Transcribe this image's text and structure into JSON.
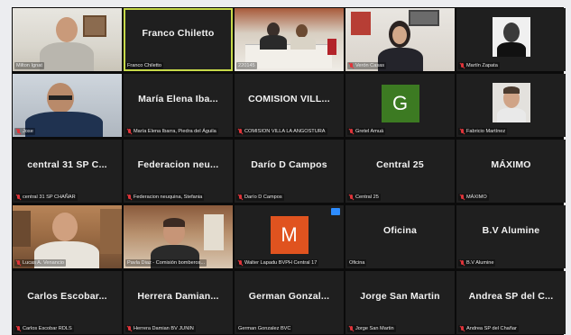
{
  "colors": {
    "active_border": "#c7d94a",
    "muted_icon": "#e0343a",
    "avatar_green": "#3c7a22",
    "avatar_orange": "#e0531f",
    "video_badge": "#2d8cff"
  },
  "tiles": [
    {
      "label": "Milton Ignat",
      "center": "",
      "muted": false
    },
    {
      "label": "Franco Chiletto",
      "center": "Franco Chiletto",
      "muted": false
    },
    {
      "label": "220145",
      "center": "",
      "muted": false
    },
    {
      "label": "Verón Casas",
      "center": "",
      "muted": true
    },
    {
      "label": "Martín Zapata",
      "center": "",
      "muted": true
    },
    {
      "label": "Jose",
      "center": "",
      "muted": true
    },
    {
      "label": "María Elena Ibarra, Piedra del Águila",
      "center": "María Elena Iba...",
      "muted": true
    },
    {
      "label": "COMISION VILLA LA ANGOSTURA",
      "center": "COMISION VILL...",
      "muted": true
    },
    {
      "label": "Gretel Amuá",
      "center": "",
      "muted": true,
      "avatar": "G"
    },
    {
      "label": "Fabricio Martínez",
      "center": "",
      "muted": true
    },
    {
      "label": "central 31 SP CHAÑAR",
      "center": "central 31 SP C...",
      "muted": true
    },
    {
      "label": "Federacion neuquina, Stefania",
      "center": "Federacion neu...",
      "muted": true
    },
    {
      "label": "Darío D Campos",
      "center": "Darío D Campos",
      "muted": true
    },
    {
      "label": "Central 25",
      "center": "Central 25",
      "muted": true
    },
    {
      "label": "MÁXIMO",
      "center": "MÁXIMO",
      "muted": true
    },
    {
      "label": "Lucas A. Venancio",
      "center": "",
      "muted": true
    },
    {
      "label": "Pavla Diaz - Comisión bomberos...",
      "center": "",
      "muted": false
    },
    {
      "label": "Walter Lapadu BVPH Central 17",
      "center": "",
      "muted": true,
      "avatar": "M"
    },
    {
      "label": "Oficina",
      "center": "Oficina",
      "muted": false
    },
    {
      "label": "B.V Alumine",
      "center": "B.V Alumine",
      "muted": true
    },
    {
      "label": "Carlos Escobar RDLS",
      "center": "Carlos Escobar...",
      "muted": true
    },
    {
      "label": "Herrera Damian BV JUNIN",
      "center": "Herrera Damian...",
      "muted": true
    },
    {
      "label": "German Gonzalez BVC",
      "center": "German Gonzal...",
      "muted": false
    },
    {
      "label": "Jorge San Martin",
      "center": "Jorge San Martin",
      "muted": true
    },
    {
      "label": "Andrea SP del Chañar",
      "center": "Andrea SP del C...",
      "muted": true
    }
  ]
}
